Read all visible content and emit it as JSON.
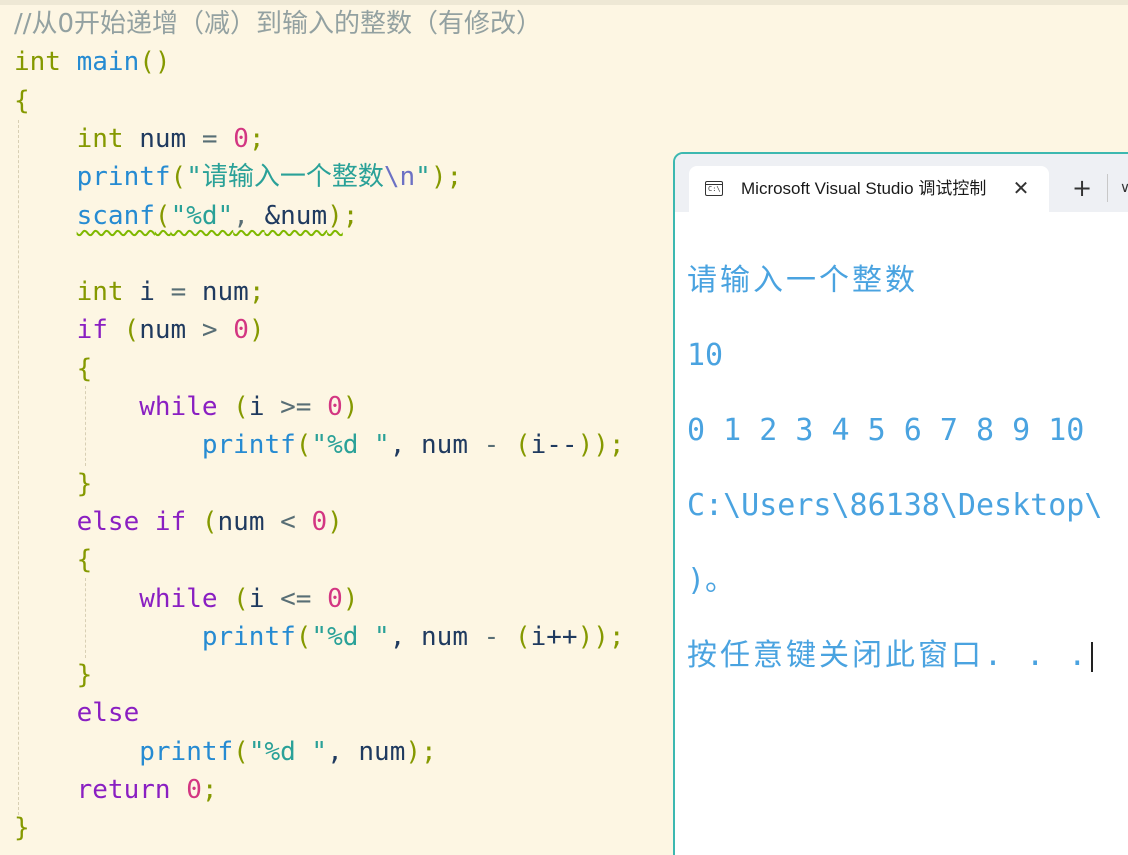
{
  "editor": {
    "lines": [
      [
        {
          "t": "//从0开始递增（减）到输入的整数（有修改）",
          "c": "comment"
        }
      ],
      [
        {
          "t": "int",
          "c": "kw-type"
        },
        {
          "t": " ",
          "c": "id"
        },
        {
          "t": "main",
          "c": "kw-fn"
        },
        {
          "t": "()",
          "c": "punct"
        }
      ],
      [
        {
          "t": "{",
          "c": "punct"
        }
      ],
      [
        {
          "t": "    ",
          "c": "id"
        },
        {
          "t": "int",
          "c": "kw-type"
        },
        {
          "t": " num ",
          "c": "id"
        },
        {
          "t": "=",
          "c": "op"
        },
        {
          "t": " ",
          "c": "id"
        },
        {
          "t": "0",
          "c": "num"
        },
        {
          "t": ";",
          "c": "punct"
        }
      ],
      [
        {
          "t": "    ",
          "c": "id"
        },
        {
          "t": "printf",
          "c": "kw-fn"
        },
        {
          "t": "(",
          "c": "punct"
        },
        {
          "t": "\"请输入一个整数",
          "c": "str"
        },
        {
          "t": "\\n",
          "c": "esc"
        },
        {
          "t": "\"",
          "c": "str"
        },
        {
          "t": ");",
          "c": "punct"
        }
      ],
      [
        {
          "t": "    ",
          "c": "id"
        },
        {
          "t": "scanf",
          "c": "kw-fn squiggle"
        },
        {
          "t": "(",
          "c": "punct squiggle"
        },
        {
          "t": "\"%d\"",
          "c": "str squiggle"
        },
        {
          "t": ", ",
          "c": "op squiggle"
        },
        {
          "t": "&num",
          "c": "id squiggle"
        },
        {
          "t": ")",
          "c": "punct squiggle"
        },
        {
          "t": ";",
          "c": "punct"
        }
      ],
      [
        {
          "t": "",
          "c": "id"
        }
      ],
      [
        {
          "t": "    ",
          "c": "id"
        },
        {
          "t": "int",
          "c": "kw-type"
        },
        {
          "t": " i ",
          "c": "id"
        },
        {
          "t": "=",
          "c": "op"
        },
        {
          "t": " num",
          "c": "id"
        },
        {
          "t": ";",
          "c": "punct"
        }
      ],
      [
        {
          "t": "    ",
          "c": "id"
        },
        {
          "t": "if",
          "c": "kw-ctrl"
        },
        {
          "t": " ",
          "c": "id"
        },
        {
          "t": "(",
          "c": "punct"
        },
        {
          "t": "num ",
          "c": "id"
        },
        {
          "t": ">",
          "c": "op"
        },
        {
          "t": " ",
          "c": "id"
        },
        {
          "t": "0",
          "c": "num"
        },
        {
          "t": ")",
          "c": "punct"
        }
      ],
      [
        {
          "t": "    ",
          "c": "id"
        },
        {
          "t": "{",
          "c": "punct"
        }
      ],
      [
        {
          "t": "        ",
          "c": "id"
        },
        {
          "t": "while",
          "c": "kw-ctrl"
        },
        {
          "t": " ",
          "c": "id"
        },
        {
          "t": "(",
          "c": "punct"
        },
        {
          "t": "i ",
          "c": "id"
        },
        {
          "t": ">=",
          "c": "op"
        },
        {
          "t": " ",
          "c": "id"
        },
        {
          "t": "0",
          "c": "num"
        },
        {
          "t": ")",
          "c": "punct"
        }
      ],
      [
        {
          "t": "            ",
          "c": "id"
        },
        {
          "t": "printf",
          "c": "kw-fn"
        },
        {
          "t": "(",
          "c": "punct"
        },
        {
          "t": "\"%d \"",
          "c": "str"
        },
        {
          "t": ", num ",
          "c": "id"
        },
        {
          "t": "-",
          "c": "op"
        },
        {
          "t": " ",
          "c": "id"
        },
        {
          "t": "(",
          "c": "punct"
        },
        {
          "t": "i--",
          "c": "id"
        },
        {
          "t": "));",
          "c": "punct"
        }
      ],
      [
        {
          "t": "    ",
          "c": "id"
        },
        {
          "t": "}",
          "c": "punct"
        }
      ],
      [
        {
          "t": "    ",
          "c": "id"
        },
        {
          "t": "else if",
          "c": "kw-ctrl"
        },
        {
          "t": " ",
          "c": "id"
        },
        {
          "t": "(",
          "c": "punct"
        },
        {
          "t": "num ",
          "c": "id"
        },
        {
          "t": "<",
          "c": "op"
        },
        {
          "t": " ",
          "c": "id"
        },
        {
          "t": "0",
          "c": "num"
        },
        {
          "t": ")",
          "c": "punct"
        }
      ],
      [
        {
          "t": "    ",
          "c": "id"
        },
        {
          "t": "{",
          "c": "punct"
        }
      ],
      [
        {
          "t": "        ",
          "c": "id"
        },
        {
          "t": "while",
          "c": "kw-ctrl"
        },
        {
          "t": " ",
          "c": "id"
        },
        {
          "t": "(",
          "c": "punct"
        },
        {
          "t": "i ",
          "c": "id"
        },
        {
          "t": "<=",
          "c": "op"
        },
        {
          "t": " ",
          "c": "id"
        },
        {
          "t": "0",
          "c": "num"
        },
        {
          "t": ")",
          "c": "punct"
        }
      ],
      [
        {
          "t": "            ",
          "c": "id"
        },
        {
          "t": "printf",
          "c": "kw-fn"
        },
        {
          "t": "(",
          "c": "punct"
        },
        {
          "t": "\"%d \"",
          "c": "str"
        },
        {
          "t": ", num ",
          "c": "id"
        },
        {
          "t": "-",
          "c": "op"
        },
        {
          "t": " ",
          "c": "id"
        },
        {
          "t": "(",
          "c": "punct"
        },
        {
          "t": "i++",
          "c": "id"
        },
        {
          "t": "));",
          "c": "punct"
        }
      ],
      [
        {
          "t": "    ",
          "c": "id"
        },
        {
          "t": "}",
          "c": "punct"
        }
      ],
      [
        {
          "t": "    ",
          "c": "id"
        },
        {
          "t": "else",
          "c": "kw-ctrl"
        }
      ],
      [
        {
          "t": "        ",
          "c": "id"
        },
        {
          "t": "printf",
          "c": "kw-fn"
        },
        {
          "t": "(",
          "c": "punct"
        },
        {
          "t": "\"%d \"",
          "c": "str"
        },
        {
          "t": ", num",
          "c": "id"
        },
        {
          "t": ");",
          "c": "punct"
        }
      ],
      [
        {
          "t": "    ",
          "c": "id"
        },
        {
          "t": "return",
          "c": "kw-ctrl"
        },
        {
          "t": " ",
          "c": "id"
        },
        {
          "t": "0",
          "c": "num"
        },
        {
          "t": ";",
          "c": "punct"
        }
      ],
      [
        {
          "t": "}",
          "c": "punct"
        }
      ]
    ]
  },
  "console": {
    "tab_icon": "terminal-icon",
    "tab_icon_text": "C:\\",
    "tab_title": "Microsoft Visual Studio 调试控制台",
    "close_glyph": "✕",
    "new_tab_glyph": "+",
    "dropdown_glyph": "∨",
    "output": [
      "请输入一个整数",
      "10",
      "0 1 2 3 4 5 6 7 8 9 10",
      "C:\\Users\\86138\\Desktop\\",
      ")。",
      "按任意键关闭此窗口. . ."
    ]
  },
  "colors": {
    "editor_bg": "#fdf6e3",
    "keyword_type": "#859900",
    "keyword_fn": "#268bd2",
    "keyword_ctrl": "#8a1fc2",
    "string": "#2aa198",
    "number": "#d33682",
    "console_text": "#4aa3e0",
    "console_border": "#3cb8b0"
  }
}
